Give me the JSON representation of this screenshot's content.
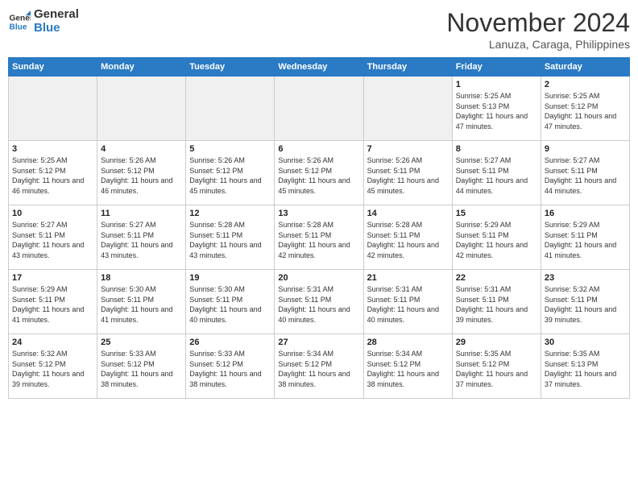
{
  "header": {
    "logo_line1": "General",
    "logo_line2": "Blue",
    "month": "November 2024",
    "location": "Lanuza, Caraga, Philippines"
  },
  "days_of_week": [
    "Sunday",
    "Monday",
    "Tuesday",
    "Wednesday",
    "Thursday",
    "Friday",
    "Saturday"
  ],
  "weeks": [
    {
      "parity": "odd",
      "days": [
        {
          "num": "",
          "info": ""
        },
        {
          "num": "",
          "info": ""
        },
        {
          "num": "",
          "info": ""
        },
        {
          "num": "",
          "info": ""
        },
        {
          "num": "",
          "info": ""
        },
        {
          "num": "1",
          "info": "Sunrise: 5:25 AM\nSunset: 5:13 PM\nDaylight: 11 hours and 47 minutes."
        },
        {
          "num": "2",
          "info": "Sunrise: 5:25 AM\nSunset: 5:12 PM\nDaylight: 11 hours and 47 minutes."
        }
      ]
    },
    {
      "parity": "even",
      "days": [
        {
          "num": "3",
          "info": "Sunrise: 5:25 AM\nSunset: 5:12 PM\nDaylight: 11 hours and 46 minutes."
        },
        {
          "num": "4",
          "info": "Sunrise: 5:26 AM\nSunset: 5:12 PM\nDaylight: 11 hours and 46 minutes."
        },
        {
          "num": "5",
          "info": "Sunrise: 5:26 AM\nSunset: 5:12 PM\nDaylight: 11 hours and 45 minutes."
        },
        {
          "num": "6",
          "info": "Sunrise: 5:26 AM\nSunset: 5:12 PM\nDaylight: 11 hours and 45 minutes."
        },
        {
          "num": "7",
          "info": "Sunrise: 5:26 AM\nSunset: 5:11 PM\nDaylight: 11 hours and 45 minutes."
        },
        {
          "num": "8",
          "info": "Sunrise: 5:27 AM\nSunset: 5:11 PM\nDaylight: 11 hours and 44 minutes."
        },
        {
          "num": "9",
          "info": "Sunrise: 5:27 AM\nSunset: 5:11 PM\nDaylight: 11 hours and 44 minutes."
        }
      ]
    },
    {
      "parity": "odd",
      "days": [
        {
          "num": "10",
          "info": "Sunrise: 5:27 AM\nSunset: 5:11 PM\nDaylight: 11 hours and 43 minutes."
        },
        {
          "num": "11",
          "info": "Sunrise: 5:27 AM\nSunset: 5:11 PM\nDaylight: 11 hours and 43 minutes."
        },
        {
          "num": "12",
          "info": "Sunrise: 5:28 AM\nSunset: 5:11 PM\nDaylight: 11 hours and 43 minutes."
        },
        {
          "num": "13",
          "info": "Sunrise: 5:28 AM\nSunset: 5:11 PM\nDaylight: 11 hours and 42 minutes."
        },
        {
          "num": "14",
          "info": "Sunrise: 5:28 AM\nSunset: 5:11 PM\nDaylight: 11 hours and 42 minutes."
        },
        {
          "num": "15",
          "info": "Sunrise: 5:29 AM\nSunset: 5:11 PM\nDaylight: 11 hours and 42 minutes."
        },
        {
          "num": "16",
          "info": "Sunrise: 5:29 AM\nSunset: 5:11 PM\nDaylight: 11 hours and 41 minutes."
        }
      ]
    },
    {
      "parity": "even",
      "days": [
        {
          "num": "17",
          "info": "Sunrise: 5:29 AM\nSunset: 5:11 PM\nDaylight: 11 hours and 41 minutes."
        },
        {
          "num": "18",
          "info": "Sunrise: 5:30 AM\nSunset: 5:11 PM\nDaylight: 11 hours and 41 minutes."
        },
        {
          "num": "19",
          "info": "Sunrise: 5:30 AM\nSunset: 5:11 PM\nDaylight: 11 hours and 40 minutes."
        },
        {
          "num": "20",
          "info": "Sunrise: 5:31 AM\nSunset: 5:11 PM\nDaylight: 11 hours and 40 minutes."
        },
        {
          "num": "21",
          "info": "Sunrise: 5:31 AM\nSunset: 5:11 PM\nDaylight: 11 hours and 40 minutes."
        },
        {
          "num": "22",
          "info": "Sunrise: 5:31 AM\nSunset: 5:11 PM\nDaylight: 11 hours and 39 minutes."
        },
        {
          "num": "23",
          "info": "Sunrise: 5:32 AM\nSunset: 5:11 PM\nDaylight: 11 hours and 39 minutes."
        }
      ]
    },
    {
      "parity": "odd",
      "days": [
        {
          "num": "24",
          "info": "Sunrise: 5:32 AM\nSunset: 5:12 PM\nDaylight: 11 hours and 39 minutes."
        },
        {
          "num": "25",
          "info": "Sunrise: 5:33 AM\nSunset: 5:12 PM\nDaylight: 11 hours and 38 minutes."
        },
        {
          "num": "26",
          "info": "Sunrise: 5:33 AM\nSunset: 5:12 PM\nDaylight: 11 hours and 38 minutes."
        },
        {
          "num": "27",
          "info": "Sunrise: 5:34 AM\nSunset: 5:12 PM\nDaylight: 11 hours and 38 minutes."
        },
        {
          "num": "28",
          "info": "Sunrise: 5:34 AM\nSunset: 5:12 PM\nDaylight: 11 hours and 38 minutes."
        },
        {
          "num": "29",
          "info": "Sunrise: 5:35 AM\nSunset: 5:12 PM\nDaylight: 11 hours and 37 minutes."
        },
        {
          "num": "30",
          "info": "Sunrise: 5:35 AM\nSunset: 5:13 PM\nDaylight: 11 hours and 37 minutes."
        }
      ]
    }
  ]
}
